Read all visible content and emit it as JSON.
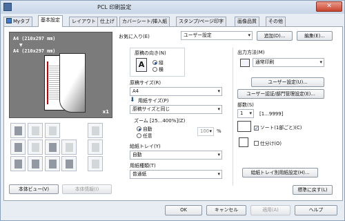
{
  "window": {
    "title": "PCL 印刷設定",
    "close": "✕"
  },
  "tabs": [
    "Myタブ",
    "基本設定",
    "レイアウト",
    "仕上げ",
    "カバーシート/挿入紙",
    "スタンプ/ページ印字",
    "画像品質",
    "その他"
  ],
  "preview": {
    "size_top": "A4 (210x297 mm)",
    "arrow": "▼",
    "size_bottom": "A4 (210x297 mm)",
    "copies": "x1"
  },
  "left_buttons": {
    "printer_view": "本体ビュー(V)",
    "printer_info": "本体情報(I)"
  },
  "favorites": {
    "label": "お気に入り(E)",
    "value": "ユーザー設定",
    "add": "追加(D)...",
    "edit": "編集(E)..."
  },
  "orientation": {
    "label": "原稿の向き(N)",
    "portrait": "縦",
    "landscape": "横",
    "icon": "A"
  },
  "original_size": {
    "label": "原稿サイズ(R)",
    "value": "A4"
  },
  "paper_size": {
    "label": "用紙サイズ(P)",
    "value": "原稿サイズと同じ"
  },
  "zoom": {
    "label": "ズーム [25...400%](Z)",
    "auto": "自動",
    "manual": "任意",
    "value": "100",
    "unit": "%"
  },
  "tray": {
    "label": "給紙トレイ(Y)",
    "value": "自動"
  },
  "paper_type": {
    "label": "用紙種類(T)",
    "value": "普通紙"
  },
  "output": {
    "label": "出力方法(M)",
    "value": "通常印刷",
    "user_settings": "ユーザー設定(U)...",
    "auth": "ユーザー認証/部門管理設定(E)..."
  },
  "copies": {
    "label": "部数(S)",
    "value": "1",
    "range": "[1...9999]",
    "collate": "ソート(1部ごと)(C)",
    "offset": "仕分け(O)"
  },
  "tray_paper_settings": "給紙トレイ別用紙設定(H)...",
  "restore_defaults": "標準に戻す(L)",
  "footer": {
    "ok": "OK",
    "cancel": "キャンセル",
    "apply": "適用(A)",
    "help": "ヘルプ"
  }
}
